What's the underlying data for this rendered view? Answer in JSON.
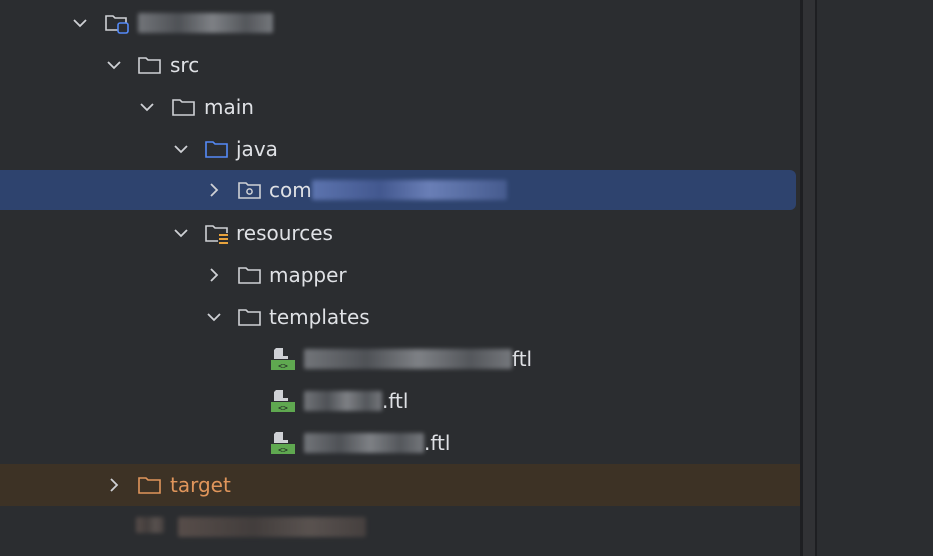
{
  "tree": {
    "root": {
      "label": ""
    },
    "src": {
      "label": "src"
    },
    "main": {
      "label": "main"
    },
    "java": {
      "label": "java"
    },
    "com": {
      "label": "com"
    },
    "resources": {
      "label": "resources"
    },
    "mapper": {
      "label": "mapper"
    },
    "templates": {
      "label": "templates"
    },
    "files": [
      {
        "suffix": "ftl"
      },
      {
        "suffix": ".ftl"
      },
      {
        "suffix": ".ftl"
      }
    ],
    "target": {
      "label": "target"
    },
    "last": {
      "label": ""
    }
  },
  "colors": {
    "background": "#2b2d30",
    "selection": "#2e436e",
    "excluded": "#3d3225",
    "java_folder": "#548af7",
    "target_folder": "#e0955b",
    "ftl_icon": "#5fa850"
  }
}
